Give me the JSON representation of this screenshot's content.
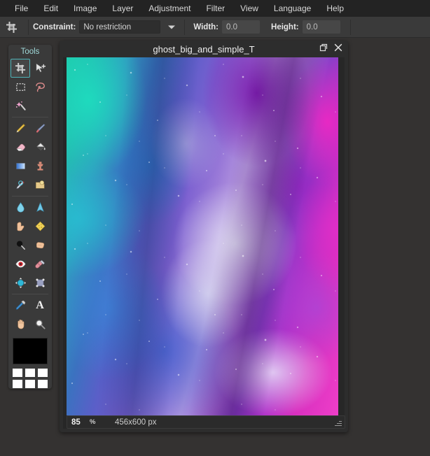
{
  "app": {
    "background_color": "#343231",
    "panel_color": "#3a3a3a",
    "accent_color": "#4fb3b8"
  },
  "menubar": {
    "items": [
      {
        "label": "File",
        "name": "menu-file"
      },
      {
        "label": "Edit",
        "name": "menu-edit"
      },
      {
        "label": "Image",
        "name": "menu-image"
      },
      {
        "label": "Layer",
        "name": "menu-layer"
      },
      {
        "label": "Adjustment",
        "name": "menu-adjustment"
      },
      {
        "label": "Filter",
        "name": "menu-filter"
      },
      {
        "label": "View",
        "name": "menu-view"
      },
      {
        "label": "Language",
        "name": "menu-language"
      },
      {
        "label": "Help",
        "name": "menu-help"
      }
    ]
  },
  "optionsbar": {
    "tool_icon": "crop-icon",
    "constraint_label": "Constraint:",
    "constraint_value": "No restriction",
    "constraint_options": [
      "No restriction"
    ],
    "width_label": "Width:",
    "width_value": "0.0",
    "height_label": "Height:",
    "height_value": "0.0"
  },
  "tools": {
    "title": "Tools",
    "selected": "crop-tool",
    "rows": [
      [
        {
          "label": "Crop",
          "name": "crop-tool",
          "glyph": "⌗",
          "active": true
        },
        {
          "label": "Move",
          "name": "move-tool",
          "glyph": "➤",
          "active": false
        }
      ],
      [
        {
          "label": "Rectangle Select",
          "name": "rectangle-select-tool",
          "glyph": "⬚",
          "active": false
        },
        {
          "label": "Lasso Select",
          "name": "lasso-select-tool",
          "glyph": "◌",
          "active": false
        }
      ],
      [
        {
          "label": "Magic Wand",
          "name": "magic-wand-tool",
          "glyph": "✨",
          "active": false
        }
      ],
      [
        {
          "label": "Pencil",
          "name": "pencil-tool",
          "glyph": "✏",
          "active": false
        },
        {
          "label": "Paint Brush",
          "name": "paint-brush-tool",
          "glyph": "🖌",
          "active": false
        }
      ],
      [
        {
          "label": "Eraser",
          "name": "eraser-tool",
          "glyph": "▰",
          "active": false
        },
        {
          "label": "Paint Bucket",
          "name": "paint-bucket-tool",
          "glyph": "◢",
          "active": false
        }
      ],
      [
        {
          "label": "Gradient",
          "name": "gradient-tool",
          "glyph": "■",
          "active": false
        },
        {
          "label": "Clone Stamp",
          "name": "clone-stamp-tool",
          "glyph": "⛏",
          "active": false
        }
      ],
      [
        {
          "label": "Clone Source",
          "name": "clone-source-tool",
          "glyph": "✎",
          "active": false
        },
        {
          "label": "Shape",
          "name": "shape-tool",
          "glyph": "◖",
          "active": false
        }
      ],
      [
        {
          "label": "Blur",
          "name": "blur-tool",
          "glyph": "💧",
          "active": false
        },
        {
          "label": "Sharpen",
          "name": "sharpen-tool",
          "glyph": "▲",
          "active": false
        }
      ],
      [
        {
          "label": "Smudge",
          "name": "smudge-tool",
          "glyph": "👆",
          "active": false
        },
        {
          "label": "Sponge",
          "name": "sponge-tool",
          "glyph": "◆",
          "active": false
        }
      ],
      [
        {
          "label": "Dodge",
          "name": "dodge-tool",
          "glyph": "⚫",
          "active": false
        },
        {
          "label": "Burn",
          "name": "burn-tool",
          "glyph": "✊",
          "active": false
        }
      ],
      [
        {
          "label": "Red Eye Removal",
          "name": "red-eye-tool",
          "glyph": "◉",
          "active": false
        },
        {
          "label": "Healing Brush",
          "name": "healing-brush-tool",
          "glyph": "💊",
          "active": false
        }
      ],
      [
        {
          "label": "Bloat",
          "name": "bloat-tool",
          "glyph": "⬤",
          "active": false
        },
        {
          "label": "Pinch",
          "name": "pinch-tool",
          "glyph": "⬛",
          "active": false
        }
      ],
      [
        {
          "label": "Color Picker",
          "name": "color-picker-tool",
          "glyph": "✒",
          "active": false
        },
        {
          "label": "Text",
          "name": "text-tool",
          "glyph": "A",
          "active": false
        }
      ],
      [
        {
          "label": "Pan",
          "name": "pan-tool",
          "glyph": "✋",
          "active": false
        },
        {
          "label": "Zoom",
          "name": "zoom-tool",
          "glyph": "🔍",
          "active": false
        }
      ]
    ],
    "primary_color": "#000000",
    "palette": [
      "#ffffff",
      "#ffffff",
      "#ffffff",
      "#ffffff",
      "#ffffff",
      "#ffffff"
    ]
  },
  "document": {
    "title": "ghost_big_and_simple_T",
    "restore_icon": "restore-window-icon",
    "close_icon": "close-icon",
    "image_description": "galaxy nebula with teal, purple and magenta clouds and white stars"
  },
  "statusbar": {
    "zoom_value": "85",
    "zoom_unit": "%",
    "dimensions": "456x600 px",
    "resize_grip": "resize-grip-icon"
  }
}
